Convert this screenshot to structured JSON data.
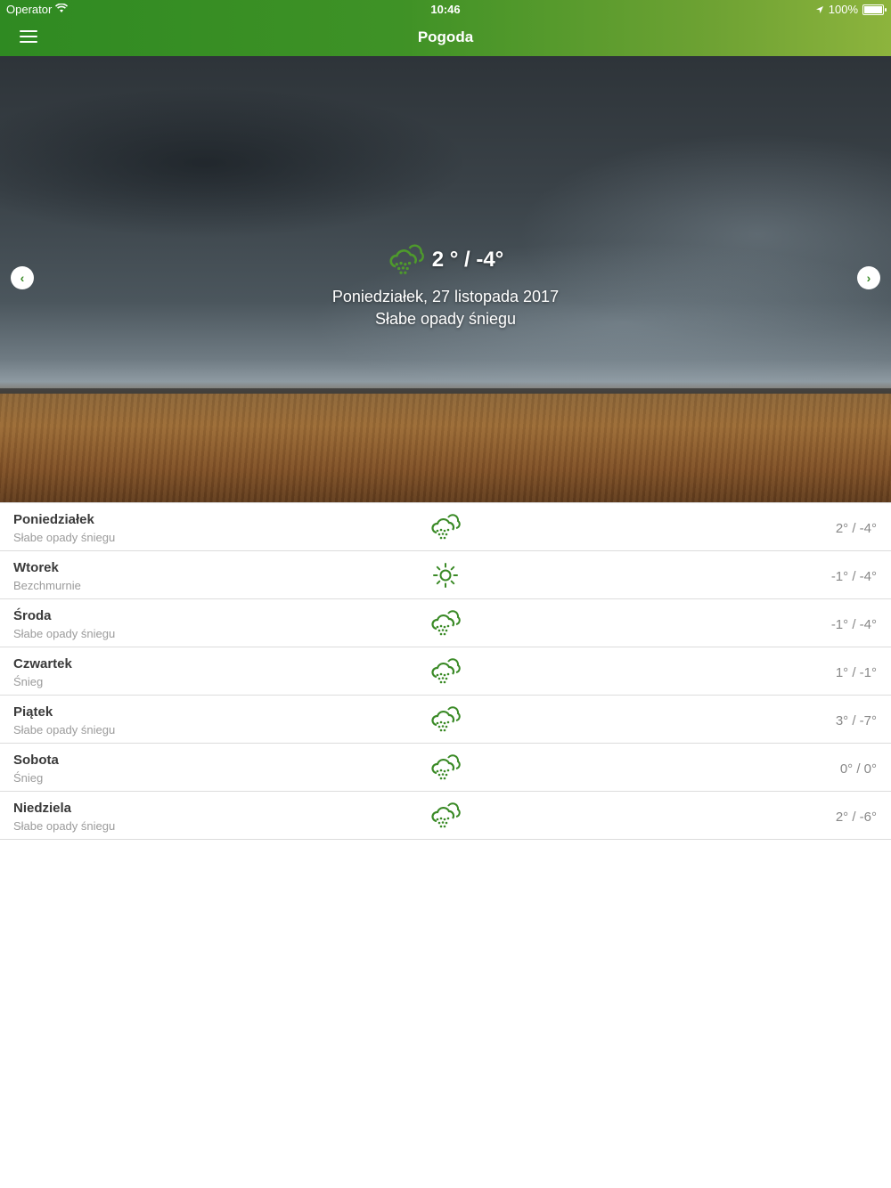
{
  "status_bar": {
    "carrier": "Operator",
    "time": "10:46",
    "battery": "100%"
  },
  "nav": {
    "title": "Pogoda"
  },
  "hero": {
    "icon": "snow-cloud-icon",
    "temperature": "2 ° / -4°",
    "date": "Poniedziałek, 27 listopada 2017",
    "description": "Słabe opady śniegu"
  },
  "forecast": [
    {
      "day": "Poniedziałek",
      "desc": "Słabe opady śniegu",
      "icon": "snow-cloud-icon",
      "temp": "2° / -4°"
    },
    {
      "day": "Wtorek",
      "desc": "Bezchmurnie",
      "icon": "sun-icon",
      "temp": "-1° / -4°"
    },
    {
      "day": "Środa",
      "desc": "Słabe opady śniegu",
      "icon": "snow-cloud-icon",
      "temp": "-1° / -4°"
    },
    {
      "day": "Czwartek",
      "desc": "Śnieg",
      "icon": "snow-cloud-icon",
      "temp": "1° / -1°"
    },
    {
      "day": "Piątek",
      "desc": "Słabe opady śniegu",
      "icon": "snow-cloud-icon",
      "temp": "3° / -7°"
    },
    {
      "day": "Sobota",
      "desc": "Śnieg",
      "icon": "snow-cloud-icon",
      "temp": "0° / 0°"
    },
    {
      "day": "Niedziela",
      "desc": "Słabe opady śniegu",
      "icon": "snow-cloud-icon",
      "temp": "2° / -6°"
    }
  ],
  "colors": {
    "accent": "#3a8a26",
    "header_start": "#2f8a22",
    "header_end": "#8db43d"
  }
}
